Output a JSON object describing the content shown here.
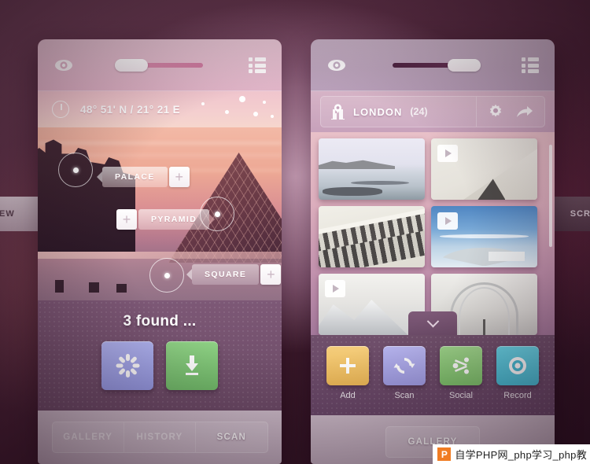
{
  "left_panel": {
    "header": {
      "eye_icon": "eye-icon",
      "list_icon": "list-view-icon",
      "slider_value": "0"
    },
    "coordbar": {
      "clock_icon": "clock-icon",
      "coordinates": "48° 51' N / 21° 21 E"
    },
    "photo": {
      "tags": [
        {
          "label": "PALACE",
          "add_label": "+"
        },
        {
          "label": "PYRAMID",
          "add_label": "+"
        },
        {
          "label": "SQUARE",
          "add_label": "+"
        }
      ]
    },
    "results": {
      "status": "3 found ...",
      "buttons": [
        {
          "name": "loading-button",
          "icon": "spinner-icon",
          "color": "#9fa4e8"
        },
        {
          "name": "download-button",
          "icon": "download-icon",
          "color": "#7cc576"
        }
      ]
    },
    "tabs": [
      {
        "label": "GALLERY",
        "active": false
      },
      {
        "label": "HISTORY",
        "active": false
      },
      {
        "label": "SCAN",
        "active": true
      }
    ]
  },
  "right_panel": {
    "header": {
      "eye_icon": "eye-icon",
      "list_icon": "list-view-icon",
      "slider_value": "100"
    },
    "location": {
      "pin_icon": "map-pin-icon",
      "name": "LONDON",
      "count": "(24)",
      "settings_icon": "gear-icon",
      "share_icon": "share-arrow-icon"
    },
    "gallery": {
      "thumbnails": [
        {
          "name": "thumb-coastline",
          "video": false
        },
        {
          "name": "thumb-white-roof",
          "video": true
        },
        {
          "name": "thumb-building-facade",
          "video": false
        },
        {
          "name": "thumb-curved-pavilion",
          "video": true
        },
        {
          "name": "thumb-snow-mountain",
          "video": true
        },
        {
          "name": "thumb-arch-structure",
          "video": false
        }
      ],
      "expand_icon": "chevron-down-icon"
    },
    "actions": [
      {
        "label": "Add",
        "icon": "plus-icon",
        "color": "#f0c268"
      },
      {
        "label": "Scan",
        "icon": "refresh-icon",
        "color": "#aaa9e8"
      },
      {
        "label": "Social",
        "icon": "share-node-icon",
        "color": "#8cc878"
      },
      {
        "label": "Record",
        "icon": "record-icon",
        "color": "#56c7dd"
      }
    ],
    "tabs": [
      {
        "label": "GALLERY",
        "active": true
      }
    ]
  },
  "side_peeks": {
    "left_label": "EW",
    "right_label": "SCR"
  },
  "watermark": {
    "logo": "P",
    "text": "自学PHP网_php学习_php教"
  }
}
